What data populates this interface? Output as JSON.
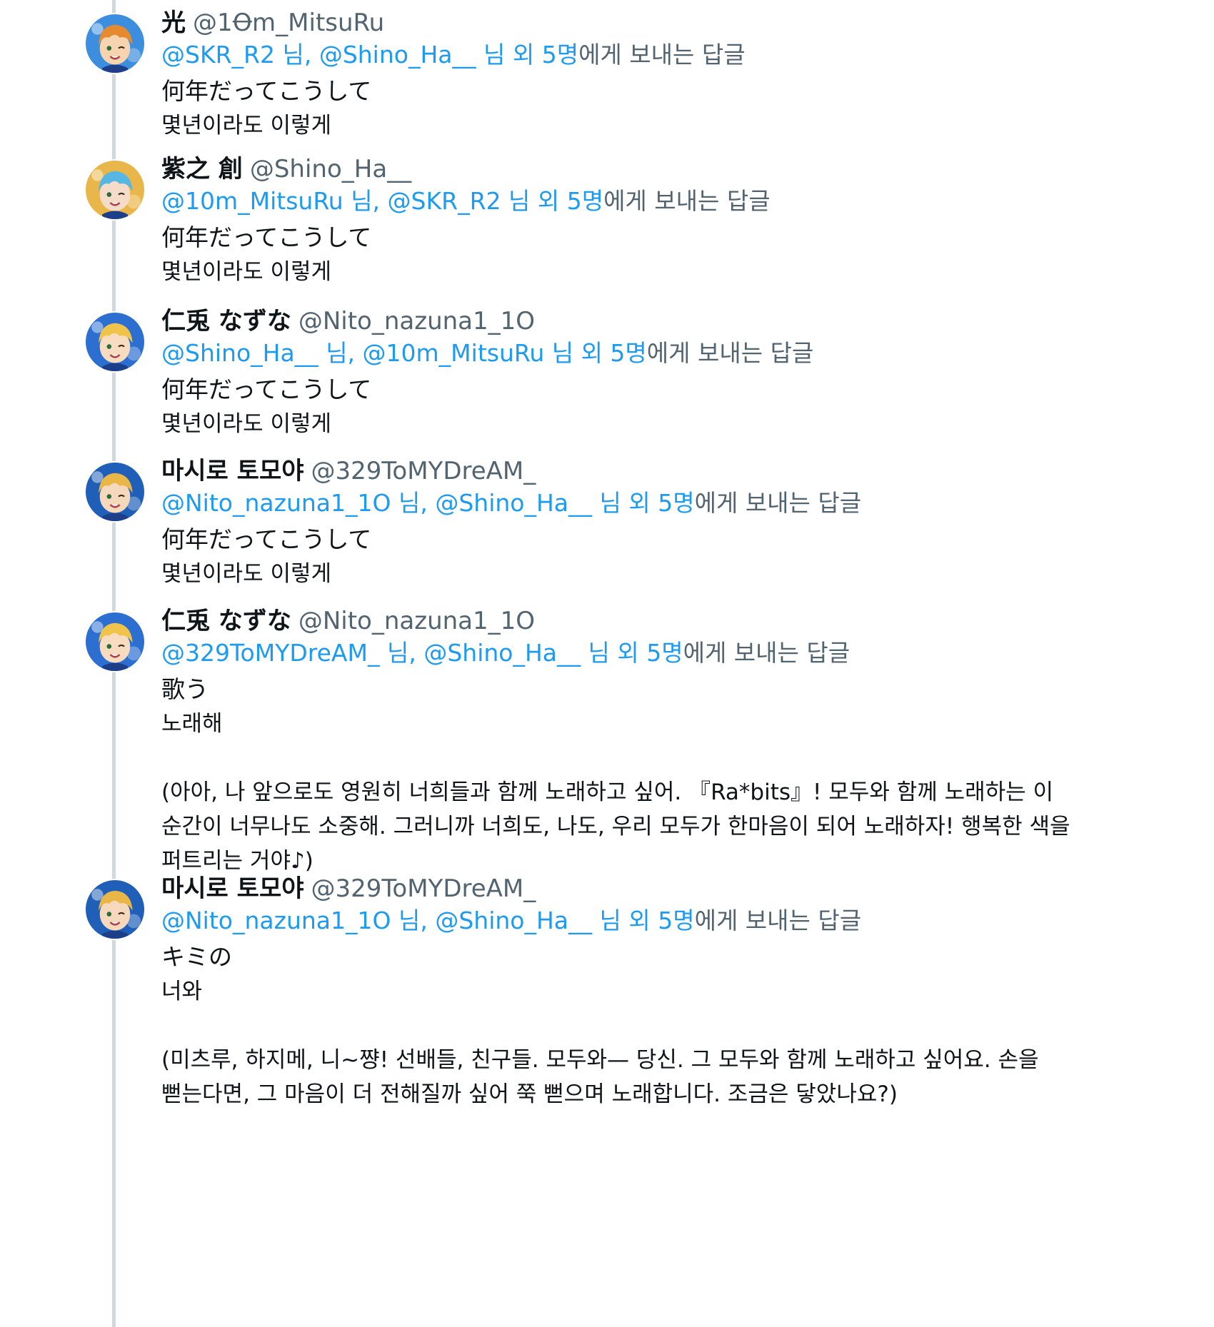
{
  "tweets": [
    {
      "name": "光",
      "handle": "@1Ꝋm_MitsuRu",
      "reply_a": "@SKR_R2",
      "reply_b": "@Shino_Ha__",
      "reply_sep": "님,",
      "reply_tail": "님 외 5명",
      "reply_suffix": "에게 보내는 답글",
      "line1": "何年だってこうして",
      "line2": "몇년이라도 이렇게",
      "avatar": "orange-hair-boy-avatar",
      "avatar_colors": [
        "#e58a2f",
        "#3d8ede",
        "#f6d4b0"
      ]
    },
    {
      "name": "紫之 創",
      "handle": "@Shino_Ha__",
      "reply_a": "@10m_MitsuRu",
      "reply_b": "@SKR_R2",
      "reply_sep": "님,",
      "reply_tail": "님 외 5명",
      "reply_suffix": "에게 보내는 답글",
      "line1": "何年だってこうして",
      "line2": "몇년이라도 이렇게",
      "avatar": "blue-hair-boy-avatar",
      "avatar_colors": [
        "#58b6e3",
        "#e9b64a",
        "#f5dcc8"
      ]
    },
    {
      "name": "仁兎 なずな",
      "handle": "@Nito_nazuna1_1O",
      "reply_a": "@Shino_Ha__",
      "reply_b": "@10m_MitsuRu",
      "reply_sep": "님,",
      "reply_tail": "님 외 5명",
      "reply_suffix": "에게 보내는 답글",
      "line1": "何年だってこうして",
      "line2": "몇년이라도 이렇게",
      "avatar": "blonde-hair-boy-avatar",
      "avatar_colors": [
        "#f0c34a",
        "#2c6fd1",
        "#f7dcc0"
      ]
    },
    {
      "name": "마시로 토모야",
      "handle": "@329ToMYDreAM_",
      "reply_a": "@Nito_nazuna1_1O",
      "reply_b": "@Shino_Ha__",
      "reply_sep": "님,",
      "reply_tail": "님 외 5명",
      "reply_suffix": "에게 보내는 답글",
      "line1": "何年だってこうして",
      "line2": "몇년이라도 이렇게",
      "avatar": "winking-blonde-boy-avatar",
      "avatar_colors": [
        "#e9b648",
        "#1f5fb8",
        "#f6d8bc"
      ]
    },
    {
      "name": "仁兎 なずな",
      "handle": "@Nito_nazuna1_1O",
      "reply_a": "@329ToMYDreAM_",
      "reply_b": "@Shino_Ha__",
      "reply_sep": "님,",
      "reply_tail": "님 외 5명",
      "reply_suffix": "에게 보내는 답글",
      "line1": "歌う",
      "line2": "노래해",
      "para": "(아아, 나 앞으로도 영원히 너희들과 함께 노래하고 싶어. 『Ra*bits』! 모두와 함께 노래하는 이\n순간이 너무나도 소중해. 그러니까 너희도, 나도, 우리 모두가 한마음이 되어 노래하자! 행복한 색을\n퍼트리는 거야♪)",
      "avatar": "blonde-hair-boy-avatar",
      "avatar_colors": [
        "#f0c34a",
        "#2c6fd1",
        "#f7dcc0"
      ]
    },
    {
      "name": "마시로 토모야",
      "handle": "@329ToMYDreAM_",
      "reply_a": "@Nito_nazuna1_1O",
      "reply_b": "@Shino_Ha__",
      "reply_sep": "님,",
      "reply_tail": "님 외 5명",
      "reply_suffix": "에게 보내는 답글",
      "line1": "キミの",
      "line2": "너와",
      "para": "(미츠루, 하지메, 니~쨩! 선배들, 친구들. 모두와— 당신. 그 모두와 함께 노래하고 싶어요. 손을\n뻗는다면, 그 마음이 더 전해질까 싶어 쭉 뻗으며 노래합니다. 조금은 닿았나요?)",
      "avatar": "winking-blonde-boy-avatar",
      "avatar_colors": [
        "#e9b648",
        "#1f5fb8",
        "#f6d8bc"
      ]
    }
  ]
}
